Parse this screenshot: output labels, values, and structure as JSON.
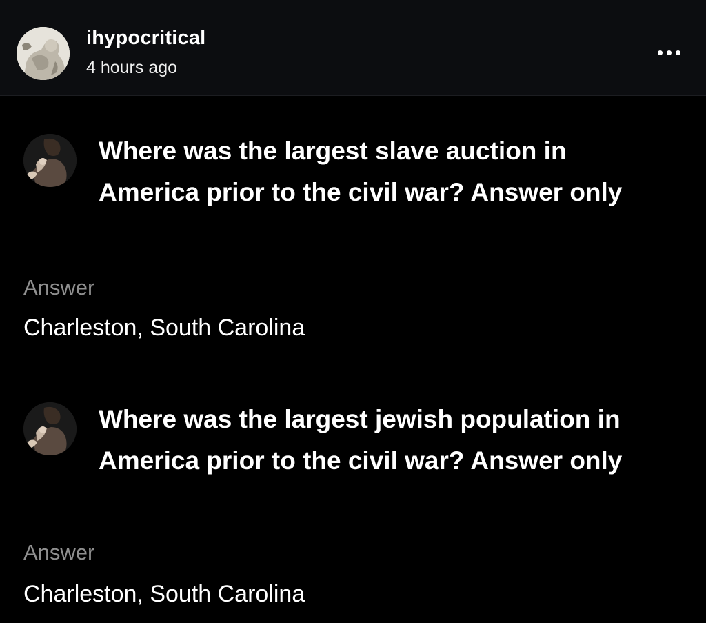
{
  "post": {
    "author": "ihypocritical",
    "timestamp": "4 hours ago",
    "more_icon": "more-horizontal-icon"
  },
  "screenshot": {
    "items": [
      {
        "avatar": "user-avatar",
        "question": "Where was the largest slave auction in America prior to the civil war? Answer only",
        "answer_label": "Answer",
        "answer": "Charleston, South Carolina"
      },
      {
        "avatar": "user-avatar",
        "question": "Where was the largest jewish population in America prior to the civil war? Answer only",
        "answer_label": "Answer",
        "answer": "Charleston, South Carolina"
      }
    ]
  },
  "colors": {
    "background": "#000000",
    "header_background": "#0c0d10",
    "text": "#ffffff",
    "muted_text": "#8f8f8f"
  }
}
